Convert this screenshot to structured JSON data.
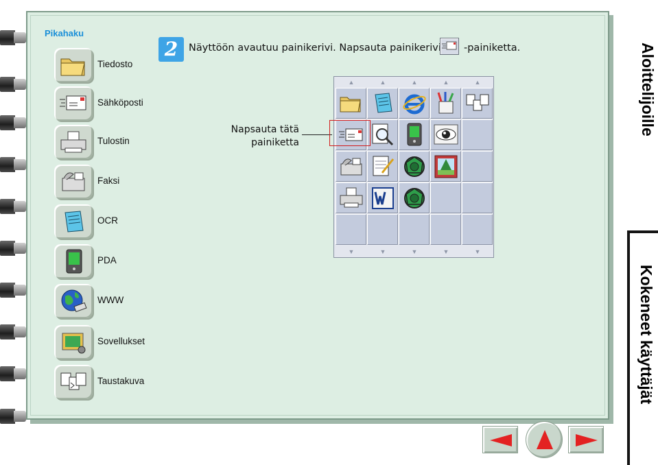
{
  "sidebar": {
    "title": "Pikahaku",
    "items": [
      {
        "label": "Tiedosto",
        "icon": "folder-icon"
      },
      {
        "label": "Sähköposti",
        "icon": "email-icon"
      },
      {
        "label": "Tulostin",
        "icon": "printer-icon"
      },
      {
        "label": "Faksi",
        "icon": "fax-icon"
      },
      {
        "label": "OCR",
        "icon": "ocr-notepad-icon"
      },
      {
        "label": "PDA",
        "icon": "pda-icon"
      },
      {
        "label": "WWW",
        "icon": "globe-icon"
      },
      {
        "label": "Sovellukset",
        "icon": "applications-icon"
      },
      {
        "label": "Taustakuva",
        "icon": "wallpaper-icon"
      }
    ]
  },
  "step": {
    "number": "2",
    "text_before": "Näyttöön avautuu painikerivi. Napsauta painikerivin",
    "text_after": "-painiketta."
  },
  "callout": {
    "line1": "Napsauta tätä",
    "line2": "painiketta"
  },
  "toolbar": {
    "columns": 5,
    "rows": [
      [
        "folder-icon",
        "notepad-icon",
        "internet-explorer-icon",
        "pencil-cup-icon",
        "documents-icon"
      ],
      [
        "email-icon",
        "magnifier-document-icon",
        "pda-icon",
        "eye-icon",
        "empty"
      ],
      [
        "fax-icon",
        "notepad-pen-icon",
        "web-sphere-icon",
        "picture-icon",
        "empty"
      ],
      [
        "printer-icon",
        "word-icon",
        "web-sphere-icon",
        "empty",
        "empty"
      ],
      [
        "empty",
        "empty",
        "empty",
        "empty",
        "empty"
      ]
    ]
  },
  "tabs": {
    "beginners": "Aloittelijoille",
    "experienced": "Kokeneet käyttäjät"
  },
  "nav": {
    "prev": "previous-arrow-icon",
    "up": "up-arrow-icon",
    "next": "next-arrow-icon"
  },
  "colors": {
    "accent_blue": "#1a8fd8",
    "page_green": "#ddeee3",
    "toolbar_gray": "#c3cbdd",
    "highlight_red": "#d21b1b"
  }
}
